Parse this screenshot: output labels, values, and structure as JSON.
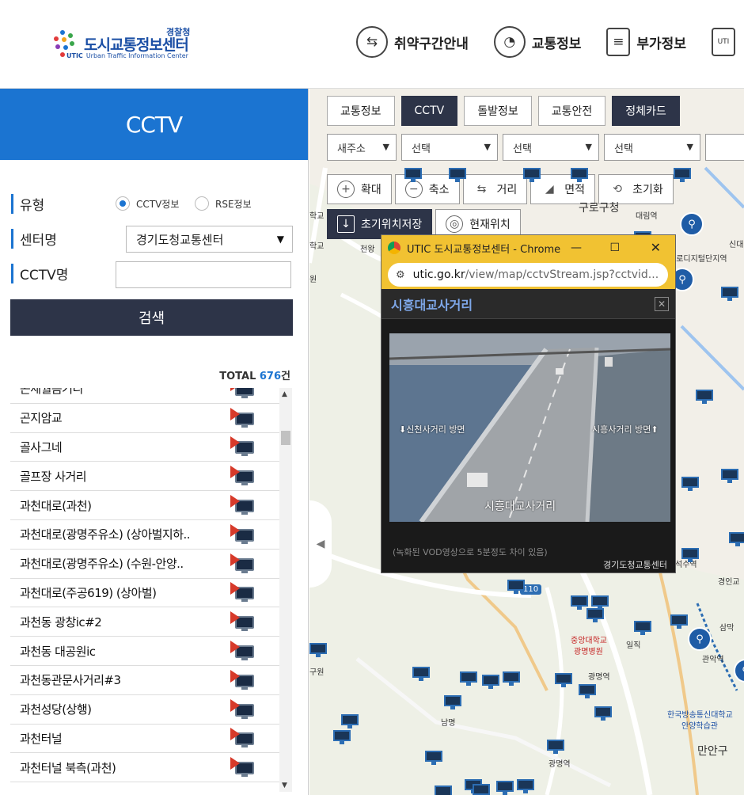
{
  "header": {
    "logo_agency": "경찰청",
    "logo_title": "도시교통정보센터",
    "logo_subtitle": "Urban Traffic Information Center",
    "logo_badge": "UTIC",
    "nav": [
      {
        "label": "취약구간안내",
        "icon": "route-icon"
      },
      {
        "label": "교통정보",
        "icon": "speedometer-icon"
      },
      {
        "label": "부가정보",
        "icon": "document-icon"
      }
    ]
  },
  "left_panel": {
    "title": "CCTV",
    "type_label": "유형",
    "radio_cctv": "CCTV정보",
    "radio_rse": "RSE정보",
    "center_label": "센터명",
    "center_value": "경기도청교통센터",
    "cctv_name_label": "CCTV명",
    "cctv_name_value": "",
    "search_button": "검색",
    "total_label": "TOTAL",
    "total_count": "676",
    "total_unit": "건",
    "items": [
      "곤세월음거리",
      "곤지암교",
      "골사그네",
      "골프장 사거리",
      "과천대로(과천)",
      "과천대로(광명주유소) (상아벌지하..",
      "과천대로(광명주유소) (수원-안양..",
      "과천대로(주공619) (상아벌)",
      "과천동 광창ic#2",
      "과천동 대공원ic",
      "과천동관문사거리#3",
      "과천성당(상행)",
      "과천터널",
      "과천터널 북측(과천)"
    ]
  },
  "map": {
    "tabs": [
      "교통정보",
      "CCTV",
      "돌발정보",
      "교통안전",
      "정체카드"
    ],
    "filters": [
      "새주소",
      "선택",
      "선택",
      "선택"
    ],
    "tools": [
      "확대",
      "축소",
      "거리",
      "면적",
      "초기화"
    ],
    "tools2": [
      "초기위치저장",
      "현재위치"
    ],
    "labels": {
      "daerim": "대림역",
      "guro": "구로구청",
      "digital": "구로디지털단지역",
      "sinrim": "신대",
      "siheung": "석수역",
      "gyeongin": "경인교",
      "samak": "삼막",
      "gwanak": "관악역",
      "gwangmyeong_hosp": "광명병원",
      "jungang": "중앙대학교",
      "ilbeon": "일직",
      "gwangmyeong_station": "광명역",
      "namgu": "남명",
      "gwangmyeongyeok": "광명역",
      "korea_univ": "한국방송통신대학교",
      "anyang_hak": "안양학습관",
      "manan": "만안구",
      "highway": "110",
      "school": "학교",
      "won": "원",
      "cheonwang": "천왕",
      "guwon": "구원",
      "dae": "대"
    }
  },
  "popup": {
    "window_title": "UTIC 도시교통정보센터 - Chrome",
    "url_host": "utic.go.kr",
    "url_path": "/view/map/cctvStream.jsp?cctvid...",
    "cctv_title": "시흥대교사거리",
    "video_left_caption": "⬇신천사거리 방면",
    "video_right_caption": "시흥사거리 방면⬆",
    "video_center_caption": "시흥대교사거리",
    "note": "(녹화된 VOD영상으로 5분정도 차이 있음)",
    "organization": "경기도청교통센터"
  },
  "colors": {
    "primary_blue": "#1b74d1",
    "dark_button": "#2d3448",
    "popup_title_bar": "#f1c232"
  }
}
